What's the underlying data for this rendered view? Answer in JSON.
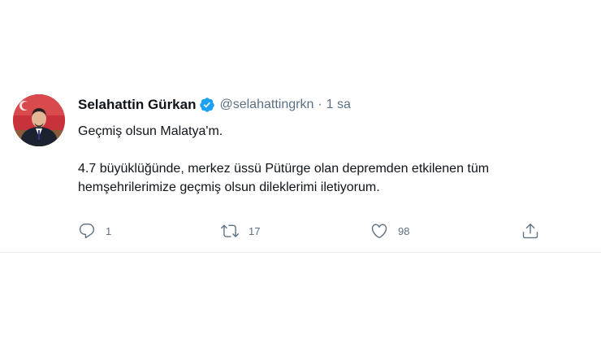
{
  "tweet": {
    "author_name": "Selahattin Gürkan",
    "handle": "@selahattingrkn",
    "separator": "·",
    "time": "1 sa",
    "text_line1": "Geçmiş olsun Malatya'm.",
    "text_line2": "4.7 büyüklüğünde, merkez üssü Pütürge olan depremden etkilenen tüm hemşehrilerimize geçmiş olsun dileklerimi iletiyorum."
  },
  "actions": {
    "replies": "1",
    "retweets": "17",
    "likes": "98"
  },
  "icons": {
    "verified": "verified-badge-icon",
    "reply": "reply-icon",
    "retweet": "retweet-icon",
    "like": "heart-icon",
    "share": "share-icon"
  },
  "colors": {
    "verified": "#1da1f2",
    "text": "#0f1419",
    "secondary": "#5b7083",
    "divider": "#e6ecf0"
  }
}
